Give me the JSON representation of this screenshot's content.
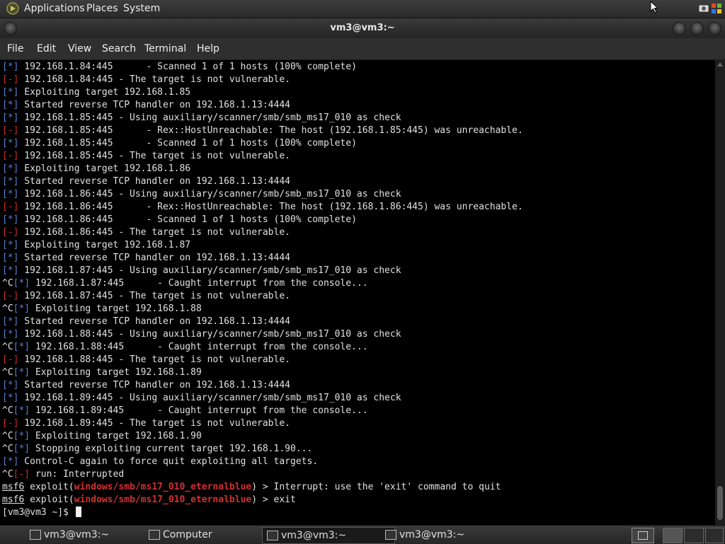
{
  "top_panel": {
    "menus": [
      "Applications",
      "Places",
      "System"
    ]
  },
  "window": {
    "title": "vm3@vm3:~"
  },
  "menubar": {
    "items": [
      "File",
      "Edit",
      "View",
      "Search",
      "Terminal",
      "Help"
    ]
  },
  "terminal": {
    "lines": [
      {
        "pre": "",
        "tag": "[*]",
        "color": "blue",
        "text": " 192.168.1.84:445      - Scanned 1 of 1 hosts (100% complete)"
      },
      {
        "pre": "",
        "tag": "[-]",
        "color": "red",
        "text": " 192.168.1.84:445 - The target is not vulnerable."
      },
      {
        "pre": "",
        "tag": "[*]",
        "color": "blue",
        "text": " Exploiting target 192.168.1.85"
      },
      {
        "pre": "",
        "tag": "[*]",
        "color": "blue",
        "text": " Started reverse TCP handler on 192.168.1.13:4444"
      },
      {
        "pre": "",
        "tag": "[*]",
        "color": "blue",
        "text": " 192.168.1.85:445 - Using auxiliary/scanner/smb/smb_ms17_010 as check"
      },
      {
        "pre": "",
        "tag": "[-]",
        "color": "red",
        "text": " 192.168.1.85:445      - Rex::HostUnreachable: The host (192.168.1.85:445) was unreachable."
      },
      {
        "pre": "",
        "tag": "[*]",
        "color": "blue",
        "text": " 192.168.1.85:445      - Scanned 1 of 1 hosts (100% complete)"
      },
      {
        "pre": "",
        "tag": "[-]",
        "color": "red",
        "text": " 192.168.1.85:445 - The target is not vulnerable."
      },
      {
        "pre": "",
        "tag": "[*]",
        "color": "blue",
        "text": " Exploiting target 192.168.1.86"
      },
      {
        "pre": "",
        "tag": "[*]",
        "color": "blue",
        "text": " Started reverse TCP handler on 192.168.1.13:4444"
      },
      {
        "pre": "",
        "tag": "[*]",
        "color": "blue",
        "text": " 192.168.1.86:445 - Using auxiliary/scanner/smb/smb_ms17_010 as check"
      },
      {
        "pre": "",
        "tag": "[-]",
        "color": "red",
        "text": " 192.168.1.86:445      - Rex::HostUnreachable: The host (192.168.1.86:445) was unreachable."
      },
      {
        "pre": "",
        "tag": "[*]",
        "color": "blue",
        "text": " 192.168.1.86:445      - Scanned 1 of 1 hosts (100% complete)"
      },
      {
        "pre": "",
        "tag": "[-]",
        "color": "red",
        "text": " 192.168.1.86:445 - The target is not vulnerable."
      },
      {
        "pre": "",
        "tag": "[*]",
        "color": "blue",
        "text": " Exploiting target 192.168.1.87"
      },
      {
        "pre": "",
        "tag": "[*]",
        "color": "blue",
        "text": " Started reverse TCP handler on 192.168.1.13:4444"
      },
      {
        "pre": "",
        "tag": "[*]",
        "color": "blue",
        "text": " 192.168.1.87:445 - Using auxiliary/scanner/smb/smb_ms17_010 as check"
      },
      {
        "pre": "^C",
        "tag": "[*]",
        "color": "blue",
        "text": " 192.168.1.87:445      - Caught interrupt from the console..."
      },
      {
        "pre": "",
        "tag": "[-]",
        "color": "red",
        "text": " 192.168.1.87:445 - The target is not vulnerable."
      },
      {
        "pre": "^C",
        "tag": "[*]",
        "color": "blue",
        "text": " Exploiting target 192.168.1.88"
      },
      {
        "pre": "",
        "tag": "[*]",
        "color": "blue",
        "text": " Started reverse TCP handler on 192.168.1.13:4444"
      },
      {
        "pre": "",
        "tag": "[*]",
        "color": "blue",
        "text": " 192.168.1.88:445 - Using auxiliary/scanner/smb/smb_ms17_010 as check"
      },
      {
        "pre": "^C",
        "tag": "[*]",
        "color": "blue",
        "text": " 192.168.1.88:445      - Caught interrupt from the console..."
      },
      {
        "pre": "",
        "tag": "[-]",
        "color": "red",
        "text": " 192.168.1.88:445 - The target is not vulnerable."
      },
      {
        "pre": "^C",
        "tag": "[*]",
        "color": "blue",
        "text": " Exploiting target 192.168.1.89"
      },
      {
        "pre": "",
        "tag": "[*]",
        "color": "blue",
        "text": " Started reverse TCP handler on 192.168.1.13:4444"
      },
      {
        "pre": "",
        "tag": "[*]",
        "color": "blue",
        "text": " 192.168.1.89:445 - Using auxiliary/scanner/smb/smb_ms17_010 as check"
      },
      {
        "pre": "^C",
        "tag": "[*]",
        "color": "blue",
        "text": " 192.168.1.89:445      - Caught interrupt from the console..."
      },
      {
        "pre": "",
        "tag": "[-]",
        "color": "red",
        "text": " 192.168.1.89:445 - The target is not vulnerable."
      },
      {
        "pre": "^C",
        "tag": "[*]",
        "color": "blue",
        "text": " Exploiting target 192.168.1.90"
      },
      {
        "pre": "^C",
        "tag": "[*]",
        "color": "blue",
        "text": " Stopping exploiting current target 192.168.1.90..."
      },
      {
        "pre": "",
        "tag": "[*]",
        "color": "blue",
        "text": " Control-C again to force quit exploiting all targets."
      },
      {
        "pre": "^C",
        "tag": "[-]",
        "color": "red",
        "text": " run: Interrupted"
      }
    ],
    "msf_lines": [
      {
        "prompt": "msf6",
        "word": " exploit(",
        "module": "windows/smb/ms17_010_eternalblue",
        "tail": ") > Interrupt: use the 'exit' command to quit"
      },
      {
        "prompt": "msf6",
        "word": " exploit(",
        "module": "windows/smb/ms17_010_eternalblue",
        "tail": ") > exit"
      }
    ],
    "shell_prompt": "[vm3@vm3 ~]$ "
  },
  "taskbar": {
    "tasks": [
      {
        "label": "vm3@vm3:~",
        "active": false
      },
      {
        "label": "Computer",
        "active": false
      },
      {
        "label": "vm3@vm3:~",
        "active": true
      },
      {
        "label": "vm3@vm3:~",
        "active": false
      }
    ]
  },
  "colors": {
    "tag_blue": "#5a7fd0",
    "tag_red": "#cc2a2a",
    "module_red": "#d23030",
    "terminal_bg": "#000000"
  }
}
